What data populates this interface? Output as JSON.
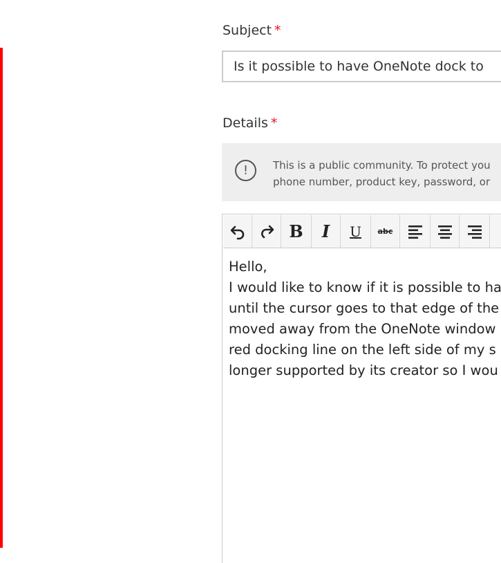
{
  "form": {
    "subject": {
      "label": "Subject",
      "required_mark": "*",
      "value": "Is it possible to have OneNote dock to"
    },
    "details": {
      "label": "Details",
      "required_mark": "*"
    },
    "notice": {
      "icon": "exclamation-circle-icon",
      "icon_glyph": "!",
      "lines": [
        "This is a public community. To protect you",
        "phone number, product key, password, or"
      ]
    },
    "toolbar": {
      "undo": "undo-icon",
      "redo": "redo-icon",
      "bold": "B",
      "italic": "I",
      "underline": "U",
      "strikethrough": "abc",
      "align_left": "align-left-icon",
      "align_center": "align-center-icon",
      "align_right": "align-right-icon"
    },
    "body_lines": [
      "Hello,",
      "I would like to know if it is possible to ha",
      "until the cursor goes to that edge of the",
      "moved away from the OneNote window",
      "red docking line on the left side of my s",
      "longer supported by its creator so I wou"
    ]
  },
  "colors": {
    "required": "#e81123",
    "dock_line": "#ff0000",
    "notice_bg": "#eeeeee"
  }
}
